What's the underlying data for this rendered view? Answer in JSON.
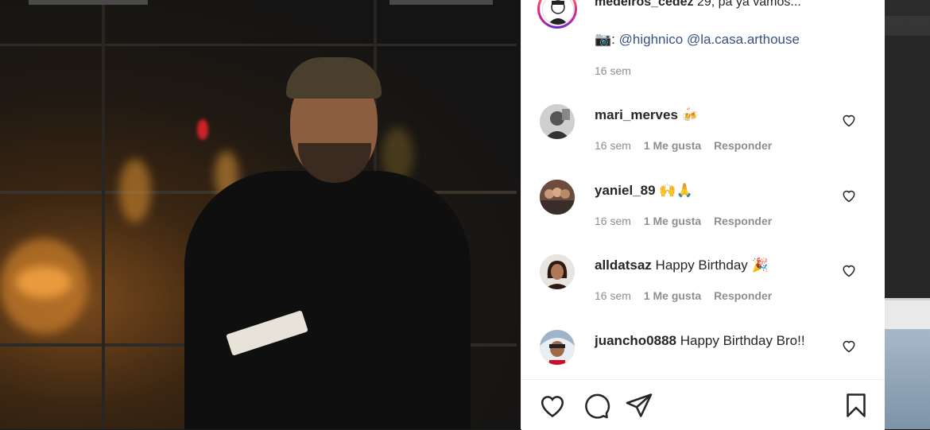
{
  "post": {
    "owner_username": "medeiros_cedez",
    "caption": "29, pa ya vamos...",
    "camera_emoji": "📷",
    "camera_colon": ":",
    "mentions": [
      "@highnico",
      "@la.casa.arthouse"
    ],
    "time": "16 sem"
  },
  "comments": [
    {
      "username": "mari_merves",
      "text": "",
      "emoji": "🍻",
      "time": "16 sem",
      "likes": "1 Me gusta",
      "reply": "Responder"
    },
    {
      "username": "yaniel_89",
      "text": "",
      "emoji": "🙌🙏",
      "time": "16 sem",
      "likes": "1 Me gusta",
      "reply": "Responder"
    },
    {
      "username": "alldatsaz",
      "text": "Happy Birthday",
      "emoji": "🎉",
      "time": "16 sem",
      "likes": "1 Me gusta",
      "reply": "Responder"
    },
    {
      "username": "juancho0888",
      "text": "Happy Birthday Bro!!",
      "emoji": "",
      "time": "",
      "likes": "",
      "reply": ""
    }
  ],
  "icons": {
    "like": "heart-icon",
    "comment": "comment-bubble-icon",
    "share": "paper-plane-icon",
    "save": "bookmark-icon",
    "comment_like": "heart-outline-icon"
  },
  "colors": {
    "text": "#262626",
    "secondary": "#8e8e8e",
    "link": "#385185"
  }
}
